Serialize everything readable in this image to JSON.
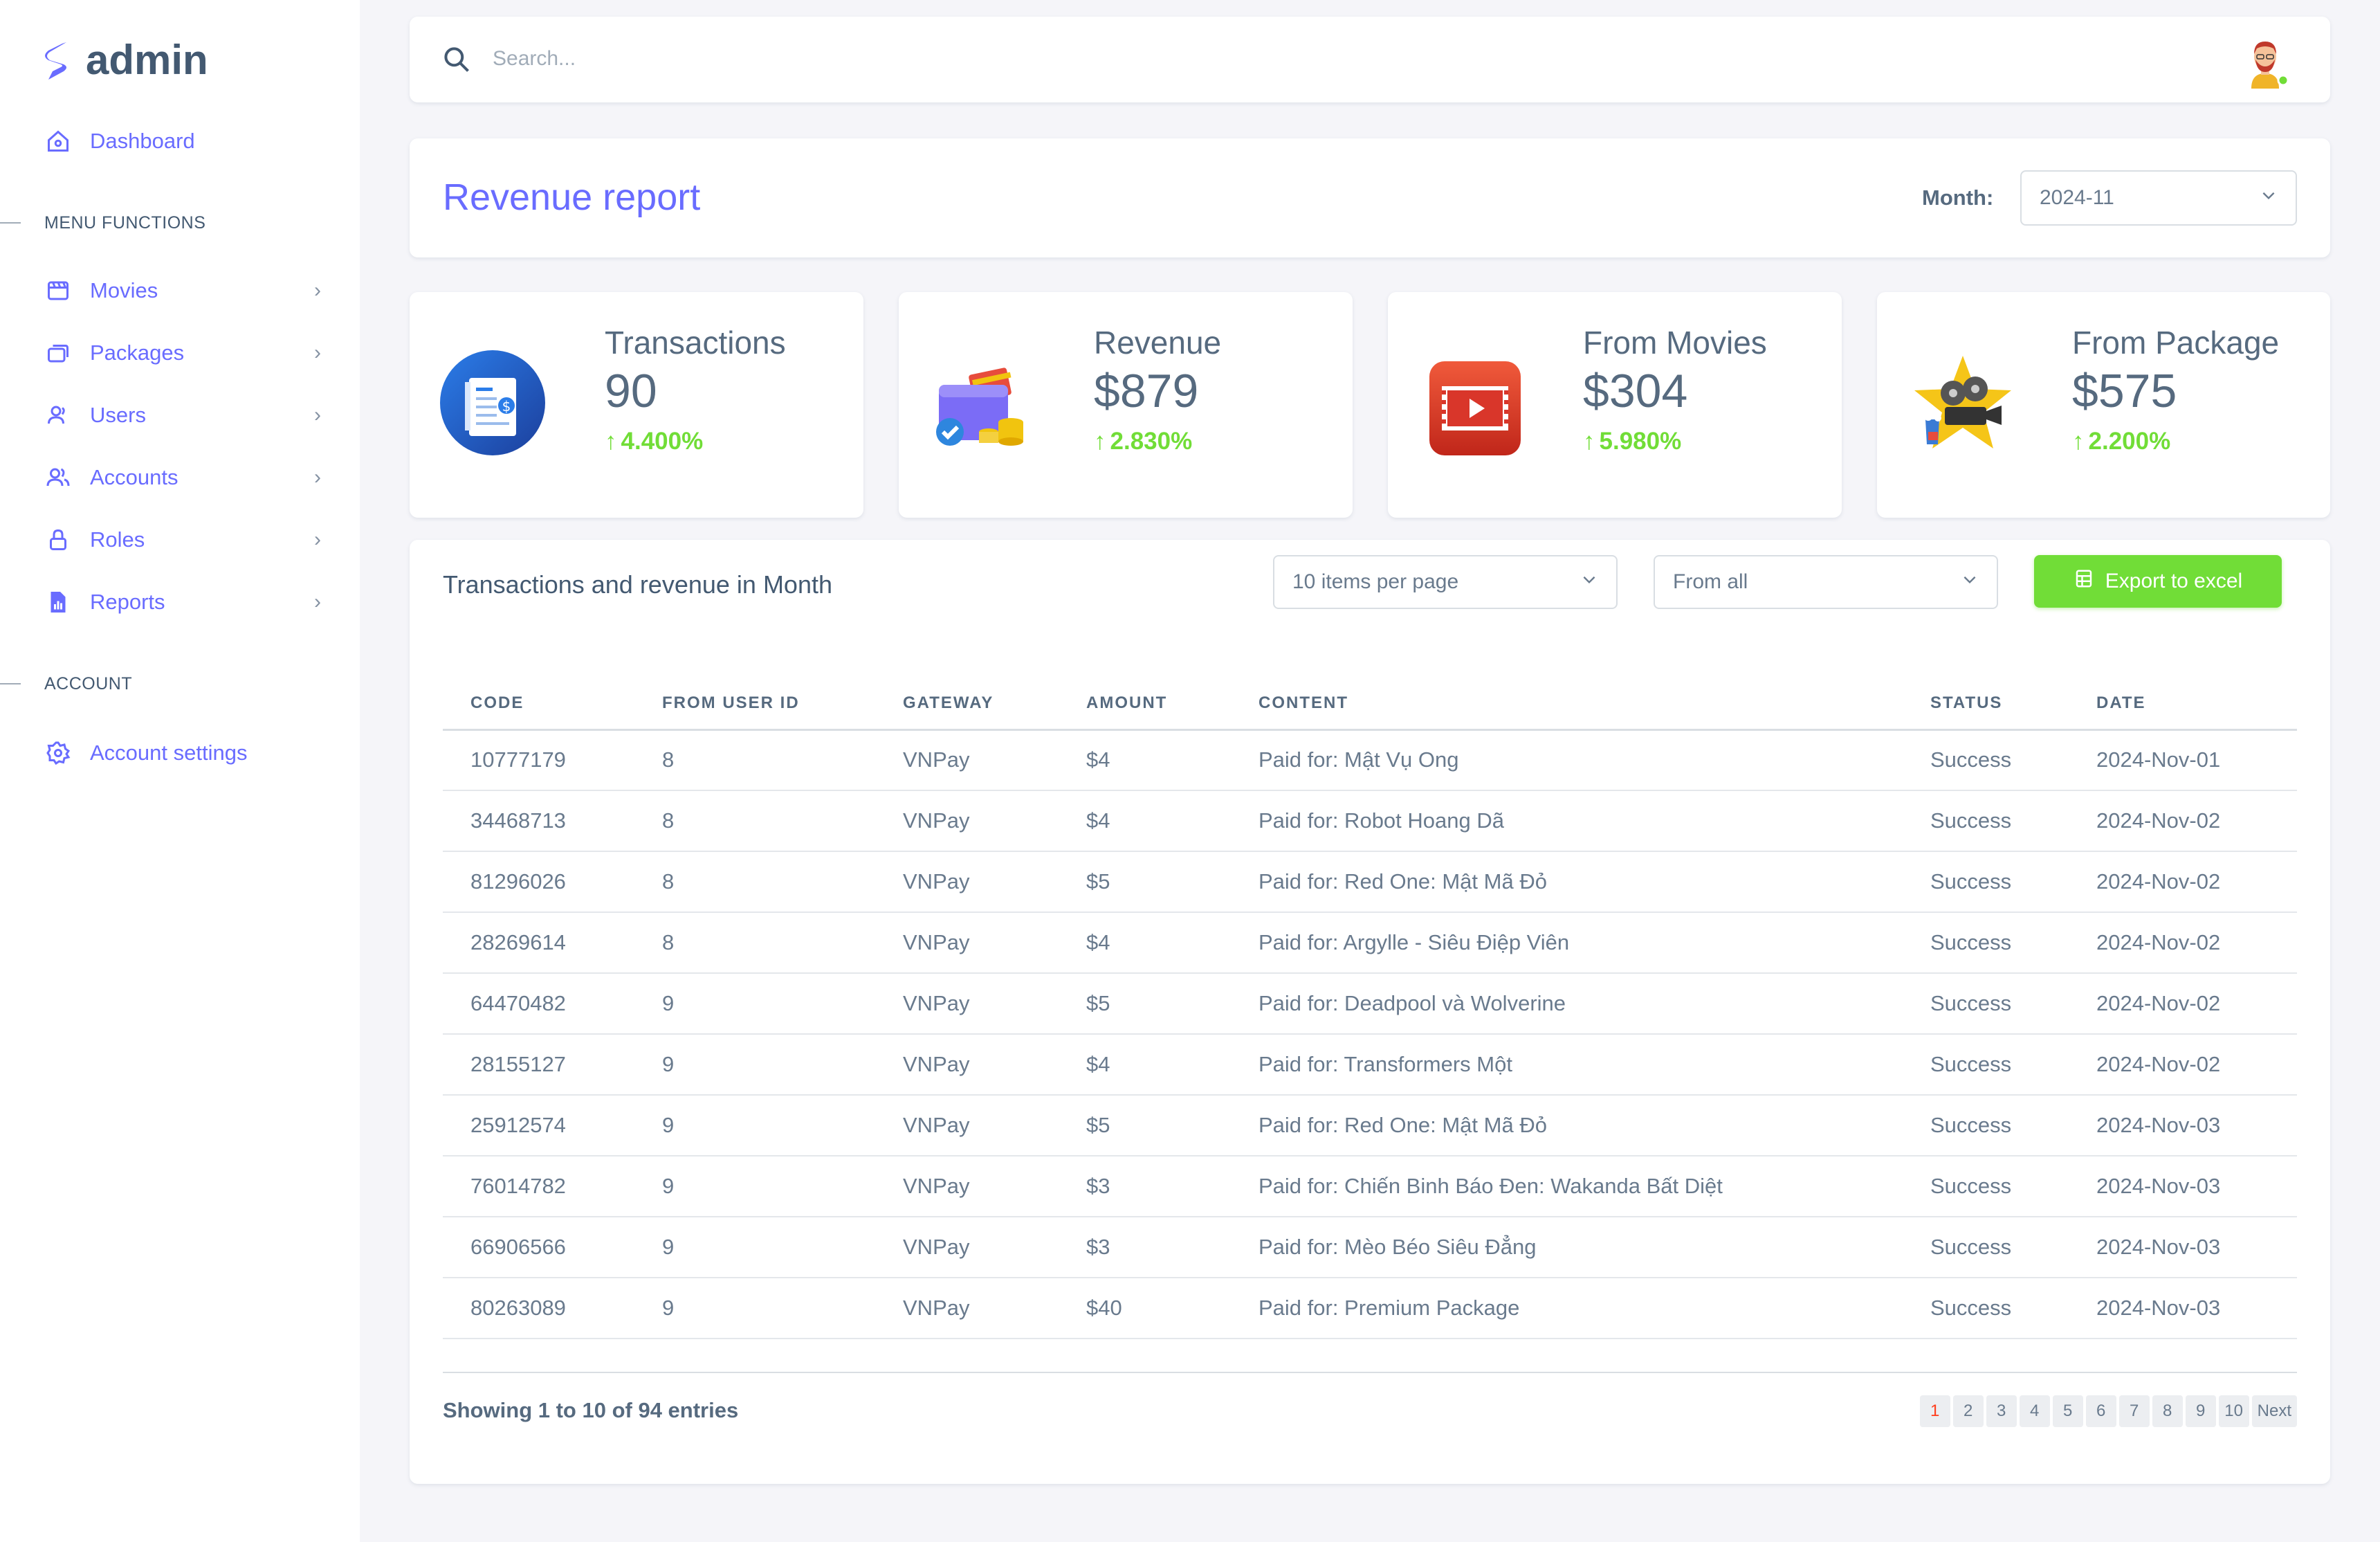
{
  "app": {
    "name": "admin"
  },
  "sidebar": {
    "dashboard": "Dashboard",
    "menu_section": "MENU FUNCTIONS",
    "items": [
      {
        "label": "Movies",
        "icon": "movie-clapper-icon"
      },
      {
        "label": "Packages",
        "icon": "packages-icon"
      },
      {
        "label": "Users",
        "icon": "user-icon"
      },
      {
        "label": "Accounts",
        "icon": "accounts-icon"
      },
      {
        "label": "Roles",
        "icon": "lock-icon"
      },
      {
        "label": "Reports",
        "icon": "report-icon"
      }
    ],
    "account_section": "ACCOUNT",
    "account_settings": "Account settings"
  },
  "search": {
    "placeholder": "Search..."
  },
  "header": {
    "title": "Revenue report",
    "month_label": "Month:",
    "month_value": "2024-11"
  },
  "stats": [
    {
      "label": "Transactions",
      "value": "90",
      "change": "4.400%",
      "icon": "invoice-icon"
    },
    {
      "label": "Revenue",
      "value": "$879",
      "change": "2.830%",
      "icon": "wallet-icon"
    },
    {
      "label": "From Movies",
      "value": "$304",
      "change": "5.980%",
      "icon": "video-play-icon"
    },
    {
      "label": "From Package",
      "value": "$575",
      "change": "2.200%",
      "icon": "cinema-star-icon"
    }
  ],
  "table_section": {
    "title": "Transactions and revenue in Month",
    "per_page": "10 items per page",
    "filter": "From all",
    "export_label": "Export to excel"
  },
  "table": {
    "columns": [
      "CODE",
      "FROM USER ID",
      "GATEWAY",
      "AMOUNT",
      "CONTENT",
      "STATUS",
      "DATE"
    ],
    "rows": [
      [
        "10777179",
        "8",
        "VNPay",
        "$4",
        "Paid for: Mật Vụ Ong",
        "Success",
        "2024-Nov-01"
      ],
      [
        "34468713",
        "8",
        "VNPay",
        "$4",
        "Paid for: Robot Hoang Dã",
        "Success",
        "2024-Nov-02"
      ],
      [
        "81296026",
        "8",
        "VNPay",
        "$5",
        "Paid for: Red One: Mật Mã Đỏ",
        "Success",
        "2024-Nov-02"
      ],
      [
        "28269614",
        "8",
        "VNPay",
        "$4",
        "Paid for: Argylle - Siêu Điệp Viên",
        "Success",
        "2024-Nov-02"
      ],
      [
        "64470482",
        "9",
        "VNPay",
        "$5",
        "Paid for: Deadpool và Wolverine",
        "Success",
        "2024-Nov-02"
      ],
      [
        "28155127",
        "9",
        "VNPay",
        "$4",
        "Paid for: Transformers Một",
        "Success",
        "2024-Nov-02"
      ],
      [
        "25912574",
        "9",
        "VNPay",
        "$5",
        "Paid for: Red One: Mật Mã Đỏ",
        "Success",
        "2024-Nov-03"
      ],
      [
        "76014782",
        "9",
        "VNPay",
        "$3",
        "Paid for: Chiến Binh Báo Đen: Wakanda Bất Diệt",
        "Success",
        "2024-Nov-03"
      ],
      [
        "66906566",
        "9",
        "VNPay",
        "$3",
        "Paid for: Mèo Béo Siêu Đẳng",
        "Success",
        "2024-Nov-03"
      ],
      [
        "80263089",
        "9",
        "VNPay",
        "$40",
        "Paid for: Premium Package",
        "Success",
        "2024-Nov-03"
      ]
    ]
  },
  "footer": {
    "showing": "Showing 1 to 10 of 94 entries",
    "pages": [
      "1",
      "2",
      "3",
      "4",
      "5",
      "6",
      "7",
      "8",
      "9",
      "10"
    ],
    "next": "Next",
    "active_page": "1"
  },
  "colors": {
    "primary": "#696cff",
    "success": "#71dd37",
    "text": "#566a7f"
  }
}
